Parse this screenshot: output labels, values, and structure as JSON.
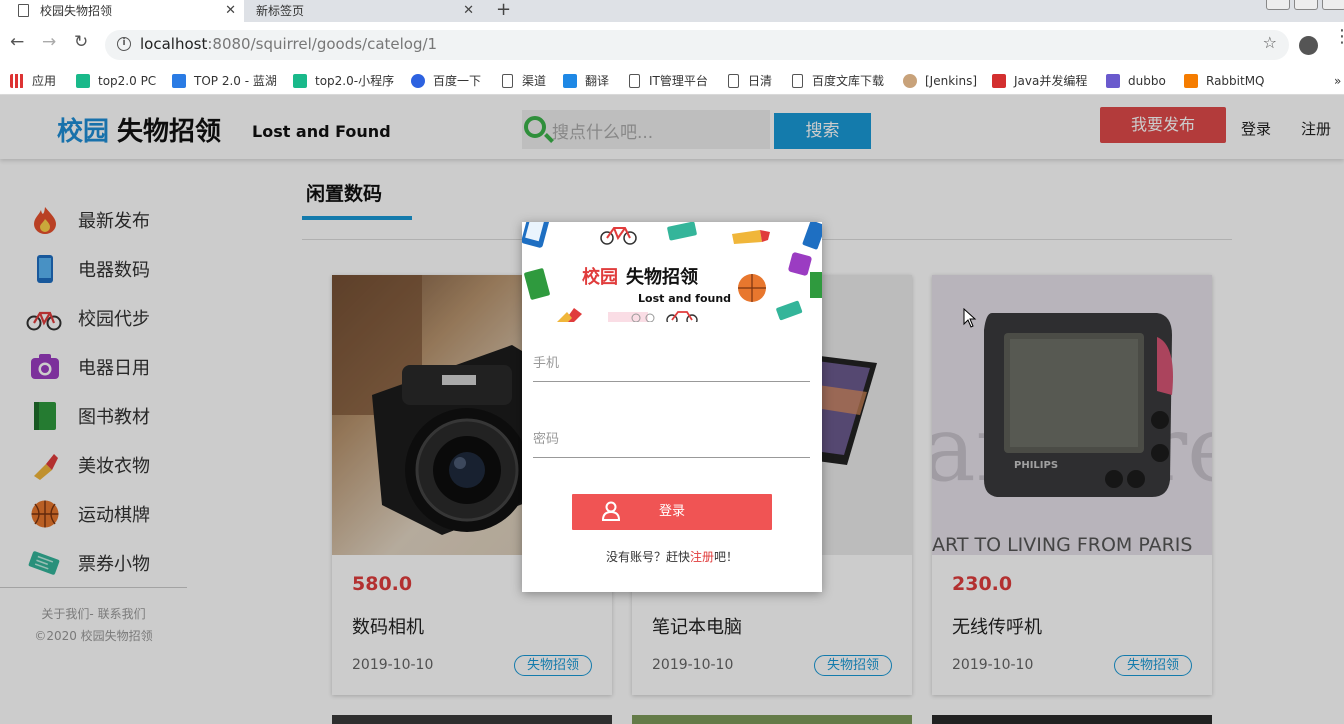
{
  "browser": {
    "tabs": [
      {
        "title": "校园失物招领",
        "active": true
      },
      {
        "title": "新标签页",
        "active": false
      }
    ],
    "url_host": "localhost",
    "url_rest": ":8080/squirrel/goods/catelog/1",
    "bookmarks": [
      "应用",
      "top2.0 PC",
      "TOP 2.0 - 蓝湖",
      "top2.0-小程序",
      "百度一下",
      "渠道",
      "翻译",
      "IT管理平台",
      "日清",
      "百度文库下载",
      "[Jenkins]",
      "Java并发编程",
      "dubbo",
      "RabbitMQ"
    ]
  },
  "header": {
    "logo_blue": "校园",
    "logo_black": "失物招领",
    "logo_en": "Lost and Found",
    "search_placeholder": "搜点什么吧...",
    "search_button": "搜索",
    "publish_button": "我要发布",
    "login": "登录",
    "register": "注册"
  },
  "sidebar": {
    "items": [
      {
        "label": "最新发布",
        "icon": "flame-icon"
      },
      {
        "label": "电器数码",
        "icon": "phone-icon"
      },
      {
        "label": "校园代步",
        "icon": "bicycle-icon"
      },
      {
        "label": "电器日用",
        "icon": "camera-icon"
      },
      {
        "label": "图书教材",
        "icon": "book-icon"
      },
      {
        "label": "美妆衣物",
        "icon": "lipstick-icon"
      },
      {
        "label": "运动棋牌",
        "icon": "basketball-icon"
      },
      {
        "label": "票券小物",
        "icon": "ticket-icon"
      }
    ],
    "footer_links": "关于我们- 联系我们",
    "copyright": "©2020 校园失物招领"
  },
  "category": {
    "title": "闲置数码"
  },
  "cards": [
    {
      "price": "580.0",
      "name": "数码相机",
      "date": "2019-10-10",
      "tag": "失物招领"
    },
    {
      "price": "",
      "name": "笔记本电脑",
      "date": "2019-10-10",
      "tag": "失物招领"
    },
    {
      "price": "230.0",
      "name": "无线传呼机",
      "date": "2019-10-10",
      "tag": "失物招领"
    }
  ],
  "modal": {
    "logo_red": "校园",
    "logo_black": "失物招领",
    "logo_en": "Lost and found",
    "phone_placeholder": "手机",
    "password_placeholder": "密码",
    "login_button": "登录",
    "register_prefix": "没有账号？赶快",
    "register_link": "注册",
    "register_suffix": "吧！"
  },
  "colors": {
    "brand_blue": "#1a9ad8",
    "brand_red": "#e03c3c",
    "search_green": "#3bb34a"
  }
}
